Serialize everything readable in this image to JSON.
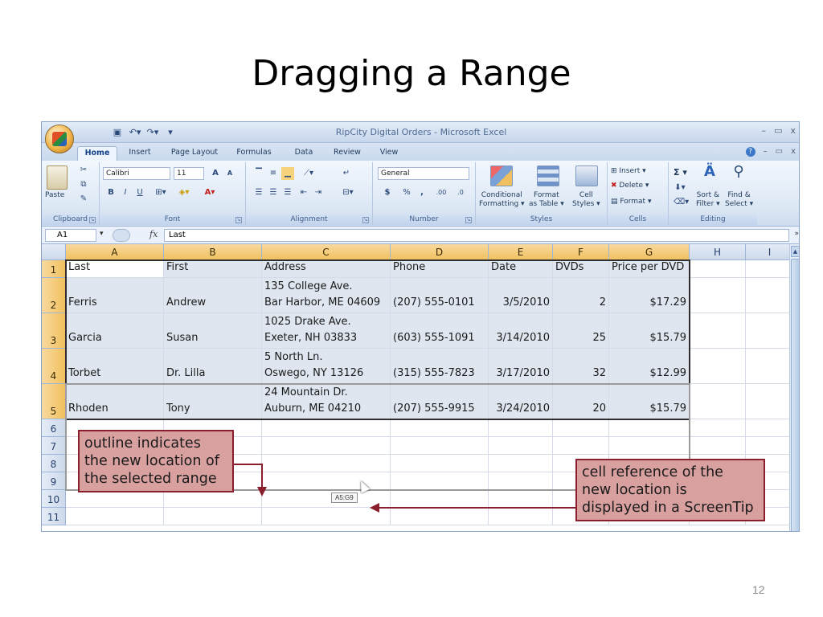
{
  "slide": {
    "title": "Dragging a Range",
    "page_number": "12"
  },
  "window": {
    "title": "RipCity Digital Orders - Microsoft Excel",
    "controls": [
      "–",
      "▭",
      "x"
    ],
    "ribbon_controls": [
      "?",
      "–",
      "▭",
      "x"
    ]
  },
  "qat": {
    "save_icon": "save-icon",
    "undo_icon": "undo-icon",
    "redo_icon": "redo-icon",
    "customize_icon": "customize-qat-icon"
  },
  "tabs": [
    "Home",
    "Insert",
    "Page Layout",
    "Formulas",
    "Data",
    "Review",
    "View"
  ],
  "ribbon": {
    "clipboard": {
      "paste": "Paste",
      "label": "Clipboard"
    },
    "font": {
      "name": "Calibri",
      "size": "11",
      "label": "Font",
      "bold": "B",
      "italic": "I",
      "underline": "U",
      "grow": "A",
      "shrink": "A"
    },
    "alignment": {
      "label": "Alignment"
    },
    "number": {
      "format": "General",
      "currency": "$",
      "percent": "%",
      "comma": ",",
      "inc_decimal": ".00",
      "dec_decimal": ".0",
      "label": "Number"
    },
    "styles": {
      "conditional": [
        "Conditional",
        "Formatting ▾"
      ],
      "format_table": [
        "Format",
        "as Table ▾"
      ],
      "cell_styles": [
        "Cell",
        "Styles ▾"
      ],
      "label": "Styles"
    },
    "cells": {
      "insert": "Insert ▾",
      "delete": "Delete ▾",
      "format": "Format ▾",
      "label": "Cells"
    },
    "editing": {
      "sum": "Σ ▾",
      "sort": [
        "Sort &",
        "Filter ▾"
      ],
      "find": [
        "Find &",
        "Select ▾"
      ],
      "label": "Editing"
    }
  },
  "formula_bar": {
    "name_box": "A1",
    "fx": "fx",
    "content": "Last"
  },
  "columns": [
    "A",
    "B",
    "C",
    "D",
    "E",
    "F",
    "G",
    "H",
    "I"
  ],
  "rows": [
    "1",
    "2",
    "3",
    "4",
    "5",
    "6",
    "7",
    "8",
    "9",
    "10",
    "11"
  ],
  "table": {
    "header": [
      "Last",
      "First",
      "Address",
      "Phone",
      "Date",
      "DVDs",
      "Price per DVD"
    ],
    "data": [
      {
        "last": "Ferris",
        "first": "Andrew",
        "addr1": "135 College Ave.",
        "addr2": "Bar Harbor, ME 04609",
        "phone": "(207) 555-0101",
        "date": "3/5/2010",
        "dvds": "2",
        "price": "$17.29"
      },
      {
        "last": "Garcia",
        "first": "Susan",
        "addr1": "1025 Drake Ave.",
        "addr2": "Exeter, NH 03833",
        "phone": "(603) 555-1091",
        "date": "3/14/2010",
        "dvds": "25",
        "price": "$15.79"
      },
      {
        "last": "Torbet",
        "first": "Dr. Lilla",
        "addr1": "5 North Ln.",
        "addr2": "Oswego, NY 13126",
        "phone": "(315) 555-7823",
        "date": "3/17/2010",
        "dvds": "32",
        "price": "$12.99"
      },
      {
        "last": "Rhoden",
        "first": "Tony",
        "addr1": "24 Mountain Dr.",
        "addr2": "Auburn, ME 04210",
        "phone": "(207) 555-9915",
        "date": "3/24/2010",
        "dvds": "20",
        "price": "$15.79"
      }
    ]
  },
  "screentip": "A5:G9",
  "callouts": {
    "left": [
      "outline indicates",
      "the new location of",
      "the selected range"
    ],
    "right": [
      "cell reference of the",
      "new location is",
      "displayed in a ScreenTip"
    ]
  },
  "colors": {
    "callout_border": "#8b1e2d",
    "callout_fill": "#d9a0a0",
    "header_selected": "#f1c15f"
  }
}
